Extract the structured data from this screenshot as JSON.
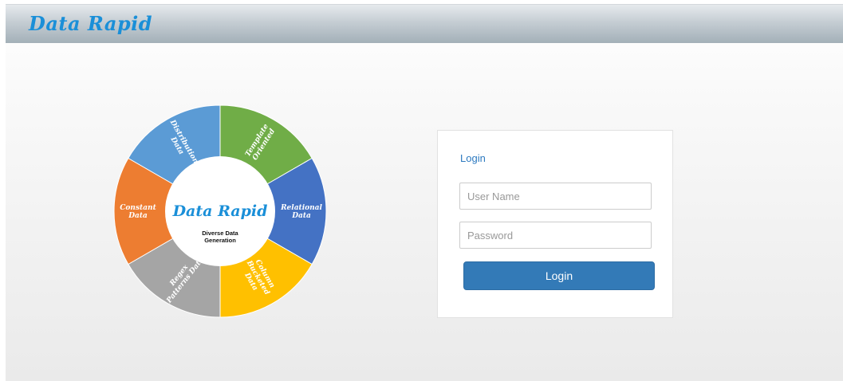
{
  "header": {
    "brand": "Data Rapid"
  },
  "wheel": {
    "center_title": "Data Rapid",
    "center_subtitle_line1": "Diverse Data",
    "center_subtitle_line2": "Generation",
    "segments": [
      {
        "id": "template",
        "color": "#70ad47",
        "lines": [
          "Template",
          "Oriented"
        ]
      },
      {
        "id": "relational",
        "color": "#4472c4",
        "lines": [
          "Relational",
          "Data"
        ]
      },
      {
        "id": "column",
        "color": "#ffc000",
        "lines": [
          "Column",
          "Bucketed",
          "Data"
        ]
      },
      {
        "id": "regex",
        "color": "#a5a5a5",
        "lines": [
          "Regex",
          "Patterns Data"
        ]
      },
      {
        "id": "constant",
        "color": "#ed7d31",
        "lines": [
          "Constant",
          "Data"
        ]
      },
      {
        "id": "distribution",
        "color": "#5b9bd5",
        "lines": [
          "Distribution",
          "Data"
        ]
      }
    ]
  },
  "login": {
    "title": "Login",
    "username_placeholder": "User Name",
    "username_value": "",
    "password_placeholder": "Password",
    "password_value": "",
    "button_label": "Login",
    "button_color": "#337ab7"
  }
}
